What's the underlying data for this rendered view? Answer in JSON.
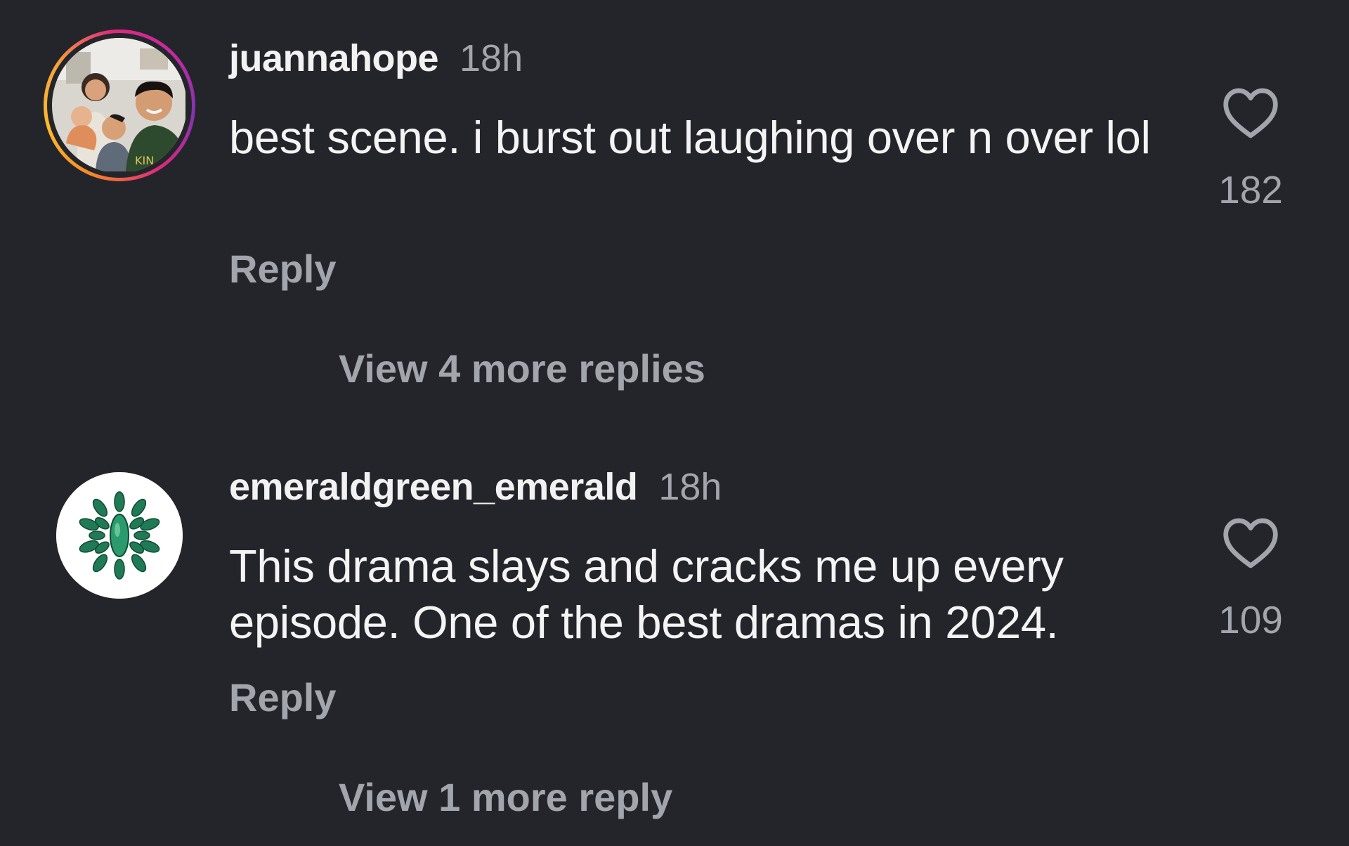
{
  "colors": {
    "background": "#24252a",
    "primary_text": "#f4f4f4",
    "secondary_text": "#a2a5ab",
    "story_ring": [
      "#f58529",
      "#dd2a7b",
      "#8134af"
    ]
  },
  "comments": [
    {
      "username": "juannahope",
      "time": "18h",
      "text": "best scene. i burst out laughing over n over lol",
      "reply_label": "Reply",
      "like_icon": "heart-outline-icon",
      "like_count": "182",
      "view_replies": "View 4 more replies",
      "avatar": "family-photo"
    },
    {
      "username": "emeraldgreen_emerald",
      "time": "18h",
      "text": "This drama slays and cracks me up every episode. One of the best dramas in 2024.",
      "reply_label": "Reply",
      "like_icon": "heart-outline-icon",
      "like_count": "109",
      "view_replies": "View 1 more reply",
      "avatar": "emerald-brooch"
    }
  ]
}
